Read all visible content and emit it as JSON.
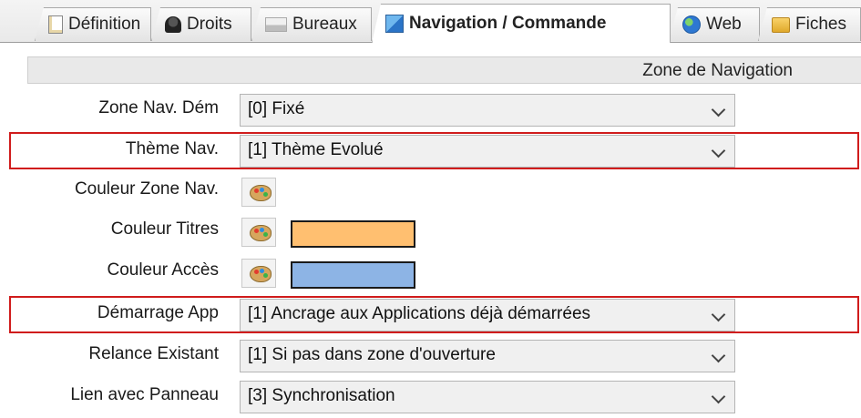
{
  "tabs": [
    {
      "label": "Définition",
      "icon": "document-icon"
    },
    {
      "label": "Droits",
      "icon": "user-icon"
    },
    {
      "label": "Bureaux",
      "icon": "desktop-icon"
    },
    {
      "label": "Navigation / Commande",
      "icon": "navigation-icon",
      "active": true
    },
    {
      "label": "Web",
      "icon": "globe-icon"
    },
    {
      "label": "Fiches",
      "icon": "folder-icon"
    }
  ],
  "section": {
    "title": "Zone de Navigation"
  },
  "fields": {
    "zone_nav_dem": {
      "label": "Zone Nav. Dém",
      "value": "[0] Fixé"
    },
    "theme_nav": {
      "label": "Thème Nav.",
      "value": "[1] Thème Evolué"
    },
    "couleur_zone_nav": {
      "label": "Couleur Zone Nav."
    },
    "couleur_titres": {
      "label": "Couleur Titres",
      "color": "#ffbf70"
    },
    "couleur_acces": {
      "label": "Couleur Accès",
      "color": "#8db4e5"
    },
    "demarrage_app": {
      "label": "Démarrage App",
      "value": "[1] Ancrage aux Applications déjà démarrées"
    },
    "relance_existant": {
      "label": "Relance Existant",
      "value": "[1] Si pas dans zone d'ouverture"
    },
    "lien_panneau": {
      "label": "Lien avec Panneau",
      "value": "[3] Synchronisation"
    }
  },
  "colors": {
    "highlight_border": "#d01c1c"
  }
}
